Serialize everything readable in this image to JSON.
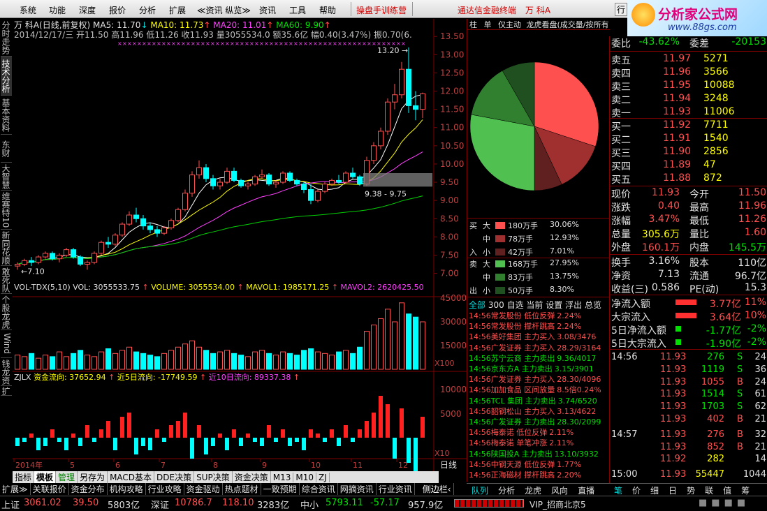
{
  "menu": {
    "items": [
      "系统",
      "功能",
      "深度",
      "报价",
      "分析",
      "扩展",
      "≪资讯 纵览≫",
      "资讯",
      "工具",
      "帮助"
    ],
    "promo": "操盘手训练营",
    "broker": "通达信金融终端",
    "stock_title": "万  科A",
    "right_btn": "行",
    "logo_text": "分析家公式网",
    "logo_url": "www.88gs.com"
  },
  "left_tabs": [
    "分时走势",
    "技术分析",
    "基本资料",
    "东财10",
    "大智慧",
    "维赛特10",
    "新同花顺",
    "敢死队",
    "个股龙虎",
    "Wind资讯",
    "钱龙资讯",
    "扩"
  ],
  "chart": {
    "title": "万  科A(日线,前复权)",
    "ma5": "MA5: 11.70",
    "ma10": "MA10: 11.73",
    "ma20": "MA20: 11.01",
    "ma60": "MA60: 9.90",
    "info_line": "2014/12/17/三  开11.50 高11.96 低11.26 收11.93 量3055534.0 额35.6亿 幅0.40(3.47%) 振0.70(6.07%) 换3",
    "high_label": "13.20",
    "low_label": "7.10",
    "range_label": "9.38 - 9.75",
    "price_ticks": [
      "13.50",
      "13.00",
      "12.50",
      "12.00",
      "11.50",
      "11.00",
      "10.50",
      "10.00",
      "9.50",
      "9.00",
      "8.50",
      "8.00",
      "7.50",
      "7.00"
    ],
    "vol_header": {
      "name": "VOL-TDX(5,10)",
      "vol": "VOL: 3055533.75",
      "volume": "VOLUME: 3055534.00",
      "mavol1": "MAVOL1: 1985171.25",
      "mavol2": "MAVOL2: 2620425.50"
    },
    "vol_ticks": [
      "45000",
      "30000",
      "15000"
    ],
    "vol_unit": "X100",
    "flow_header": {
      "name": "ZJLX",
      "flow": "资金流向: 37652.94",
      "d5": "近5日流向: -17749.59",
      "d10": "近10日流向: 89337.38"
    },
    "flow_ticks": [
      "10000",
      "5000"
    ],
    "flow_unit": "X10",
    "dates": [
      "2014年",
      "5",
      "6",
      "7",
      "8",
      "9",
      "10",
      "11",
      "12"
    ],
    "period": "日线"
  },
  "chart_tabs": [
    "指标",
    "模板",
    "管理",
    "另存为",
    "MACD基本",
    "DDE决策",
    "SUP决策",
    "资金决策",
    "M13",
    "M10",
    "ZJ"
  ],
  "pie": {
    "tabs": [
      "柱",
      "单",
      "仅主动",
      "龙虎看盘(成交量/按所有"
    ],
    "buy": [
      {
        "label": "大",
        "value": "180万手",
        "pct": "30.06%",
        "color": "#ff5050"
      },
      {
        "label": "中",
        "value": "78万手",
        "pct": "12.93%",
        "color": "#a03030"
      },
      {
        "label": "小",
        "value": "42万手",
        "pct": "7.01%",
        "color": "#602020"
      }
    ],
    "sell": [
      {
        "label": "大",
        "value": "168万手",
        "pct": "27.95%",
        "color": "#50c050"
      },
      {
        "label": "中",
        "value": "83万手",
        "pct": "13.75%",
        "color": "#308030"
      },
      {
        "label": "小",
        "value": "50万手",
        "pct": "8.30%",
        "color": "#205020"
      }
    ],
    "buy_side": [
      "买",
      "入"
    ],
    "sell_side": [
      "卖",
      "出"
    ]
  },
  "news": {
    "tabs": [
      "全部",
      "300",
      "自选",
      "当前",
      "设置",
      "浮出",
      "总览"
    ],
    "items": [
      {
        "t": "14:56",
        "s": "常发股份 低位反弹",
        "v": "2.24%",
        "c": "red"
      },
      {
        "t": "14:56",
        "s": "常发股份 撑杆跳高",
        "v": "2.24%",
        "c": "red"
      },
      {
        "t": "14:56",
        "s": "美好集团 主力买入",
        "v": "3.08/3476",
        "c": "red"
      },
      {
        "t": "14:56",
        "s": "广发证券 主力买入",
        "v": "28.29/3164",
        "c": "red"
      },
      {
        "t": "14:56",
        "s": "苏宁云商 主力卖出",
        "v": "9.36/4017",
        "c": "grn"
      },
      {
        "t": "14:56",
        "s": "京东方A 主力卖出",
        "v": "3.15/3901",
        "c": "grn"
      },
      {
        "t": "14:56",
        "s": "广发证券 主力买入",
        "v": "28.30/4096",
        "c": "red"
      },
      {
        "t": "14:56",
        "s": "加加食品 区间放量",
        "v": "8.5倍0.24%",
        "c": "red"
      },
      {
        "t": "14:56",
        "s": "TCL 集团 主力卖出",
        "v": "3.74/6520",
        "c": "grn"
      },
      {
        "t": "14:56",
        "s": "韶钢松山 主力买入",
        "v": "3.13/4622",
        "c": "red"
      },
      {
        "t": "14:56",
        "s": "广发证券 主力卖出",
        "v": "28.30/2099",
        "c": "grn"
      },
      {
        "t": "14:56",
        "s": "梅泰诺   低位反弹",
        "v": "2.11%",
        "c": "red"
      },
      {
        "t": "14:56",
        "s": "梅泰诺   单笔冲涨",
        "v": "2.11%",
        "c": "red"
      },
      {
        "t": "14:56",
        "s": "陕国投A 主力卖出",
        "v": "13.10/3932",
        "c": "grn"
      },
      {
        "t": "14:56",
        "s": "中钢天源 低位反弹",
        "v": "1.77%",
        "c": "red"
      },
      {
        "t": "14:56",
        "s": "正海磁材 撑杆跳高",
        "v": "2.20%",
        "c": "red"
      }
    ]
  },
  "right_tabs": [
    "队列",
    "分析",
    "龙虎",
    "风向",
    "直播"
  ],
  "orderbook": {
    "wb": {
      "l": "委比",
      "v": "-43.62%",
      "l2": "委差",
      "v2": "-20153"
    },
    "asks": [
      {
        "l": "卖五",
        "p": "11.97",
        "q": "5271"
      },
      {
        "l": "卖四",
        "p": "11.96",
        "q": "3566"
      },
      {
        "l": "卖三",
        "p": "11.95",
        "q": "10088"
      },
      {
        "l": "卖二",
        "p": "11.94",
        "q": "3248"
      },
      {
        "l": "卖一",
        "p": "11.93",
        "q": "11006"
      }
    ],
    "bids": [
      {
        "l": "买一",
        "p": "11.92",
        "q": "7711"
      },
      {
        "l": "买二",
        "p": "11.91",
        "q": "1540"
      },
      {
        "l": "买三",
        "p": "11.90",
        "q": "2856"
      },
      {
        "l": "买四",
        "p": "11.89",
        "q": "47"
      },
      {
        "l": "买五",
        "p": "11.88",
        "q": "872"
      }
    ],
    "stats": [
      {
        "l": "现价",
        "v": "11.93",
        "l2": "今开",
        "v2": "11.50"
      },
      {
        "l": "涨跌",
        "v": "0.40",
        "l2": "最高",
        "v2": "11.96"
      },
      {
        "l": "涨幅",
        "v": "3.47%",
        "l2": "最低",
        "v2": "11.26"
      },
      {
        "l": "总量",
        "v": "305.6万",
        "l2": "量比",
        "v2": "1.60"
      },
      {
        "l": "外盘",
        "v": "160.1万",
        "l2": "内盘",
        "v2": "145.5万"
      }
    ],
    "stats2": [
      {
        "l": "换手",
        "v": "3.16%",
        "l2": "股本",
        "v2": "110亿"
      },
      {
        "l": "净资",
        "v": "7.13",
        "l2": "流通",
        "v2": "96.7亿"
      },
      {
        "l": "收益(三)",
        "v": "0.586",
        "l2": "PE(动)",
        "v2": "15.3"
      }
    ],
    "flows": [
      {
        "l": "净流入额",
        "v": "3.77亿",
        "p": "11%",
        "c": "red"
      },
      {
        "l": "大宗流入",
        "v": "3.64亿",
        "p": "10%",
        "c": "red"
      },
      {
        "l": "5日净流入额",
        "v": "-1.77亿",
        "p": "-2%",
        "c": "grn"
      },
      {
        "l": "5日大宗流入",
        "v": "-1.90亿",
        "p": "-2%",
        "c": "grn"
      }
    ],
    "ticks": [
      {
        "t": "14:56",
        "p": "11.93",
        "q": "276",
        "d": "S",
        "n": "24"
      },
      {
        "t": "",
        "p": "11.93",
        "q": "1119",
        "d": "S",
        "n": "36"
      },
      {
        "t": "",
        "p": "11.93",
        "q": "1055",
        "d": "B",
        "n": "24"
      },
      {
        "t": "",
        "p": "11.93",
        "q": "1514",
        "d": "S",
        "n": "61"
      },
      {
        "t": "",
        "p": "11.93",
        "q": "1703",
        "d": "S",
        "n": "62"
      },
      {
        "t": "",
        "p": "11.93",
        "q": "402",
        "d": "B",
        "n": "21"
      },
      {
        "t": "14:57",
        "p": "11.93",
        "q": "276",
        "d": "B",
        "n": "32"
      },
      {
        "t": "",
        "p": "11.93",
        "q": "852",
        "d": "B",
        "n": "21"
      },
      {
        "t": "",
        "p": "11.92",
        "q": "282",
        "d": "",
        "n": "14"
      },
      {
        "t": "15:00",
        "p": "11.93",
        "q": "55447",
        "d": "",
        "n": "1044"
      }
    ],
    "bottom_tabs": [
      "笔",
      "价",
      "细",
      "日",
      "势",
      "联",
      "值",
      "筹"
    ]
  },
  "bottom_tabs": [
    "扩展≫",
    "关联报价",
    "资金分布",
    "机构攻略",
    "行业攻略",
    "资金驱动",
    "热点题材",
    "一致预期",
    "综合资讯",
    "网摘资讯",
    "行业资讯",
    "侧边栏‹"
  ],
  "status": {
    "sh_label": "上证",
    "sh_val": "3061.02",
    "sh_chg": "39.50",
    "sh_amt": "5803亿",
    "sz_label": "深证",
    "sz_val": "10786.7",
    "sz_chg": "118.10",
    "sz_amt": "3283亿",
    "zx_label": "中小",
    "zx_val": "5793.11",
    "zx_chg": "-57.17",
    "zx_amt": "957.9亿",
    "conn": "VIP_招商北京5"
  },
  "candles": [
    [
      7.2,
      7.3,
      7.1,
      7.25
    ],
    [
      7.25,
      7.4,
      7.2,
      7.35
    ],
    [
      7.35,
      7.45,
      7.2,
      7.3
    ],
    [
      7.3,
      7.5,
      7.25,
      7.45
    ],
    [
      7.45,
      7.6,
      7.4,
      7.55
    ],
    [
      7.55,
      7.6,
      7.35,
      7.4
    ],
    [
      7.4,
      7.55,
      7.3,
      7.5
    ],
    [
      7.5,
      7.7,
      7.45,
      7.65
    ],
    [
      7.65,
      7.7,
      7.4,
      7.45
    ],
    [
      7.45,
      7.5,
      7.2,
      7.25
    ],
    [
      7.25,
      7.35,
      7.1,
      7.3
    ],
    [
      7.3,
      7.6,
      7.25,
      7.55
    ],
    [
      7.55,
      7.9,
      7.5,
      7.85
    ],
    [
      7.85,
      8.0,
      7.7,
      7.8
    ],
    [
      7.8,
      8.1,
      7.75,
      8.05
    ],
    [
      8.05,
      8.4,
      8.0,
      8.35
    ],
    [
      8.35,
      8.7,
      8.3,
      8.6
    ],
    [
      8.6,
      8.8,
      8.4,
      8.5
    ],
    [
      8.5,
      8.6,
      8.2,
      8.3
    ],
    [
      8.3,
      8.4,
      8.1,
      8.2
    ],
    [
      8.2,
      8.3,
      8.0,
      8.1
    ],
    [
      8.1,
      8.3,
      8.05,
      8.25
    ],
    [
      8.25,
      8.5,
      8.2,
      8.45
    ],
    [
      8.45,
      8.8,
      8.4,
      8.75
    ],
    [
      8.75,
      9.3,
      8.7,
      9.2
    ],
    [
      9.2,
      9.8,
      9.1,
      9.7
    ],
    [
      9.7,
      10.1,
      9.6,
      9.9
    ],
    [
      9.9,
      10.0,
      9.5,
      9.6
    ],
    [
      9.6,
      9.7,
      9.3,
      9.4
    ],
    [
      9.4,
      9.6,
      9.3,
      9.5
    ],
    [
      9.5,
      9.9,
      9.45,
      9.8
    ],
    [
      9.8,
      9.9,
      9.5,
      9.55
    ],
    [
      9.55,
      9.6,
      9.35,
      9.4
    ],
    [
      9.4,
      9.5,
      9.3,
      9.45
    ],
    [
      9.45,
      9.7,
      9.4,
      9.65
    ],
    [
      9.65,
      9.85,
      9.6,
      9.7
    ],
    [
      9.7,
      9.75,
      9.4,
      9.45
    ],
    [
      9.45,
      9.55,
      9.35,
      9.5
    ],
    [
      9.5,
      9.8,
      9.45,
      9.75
    ],
    [
      9.75,
      9.8,
      9.5,
      9.55
    ],
    [
      9.55,
      9.6,
      9.4,
      9.45
    ],
    [
      9.45,
      9.5,
      9.2,
      9.3
    ],
    [
      9.3,
      9.45,
      8.9,
      9.0
    ],
    [
      9.0,
      9.3,
      8.95,
      9.25
    ],
    [
      9.25,
      9.5,
      9.2,
      9.45
    ],
    [
      9.45,
      9.6,
      9.4,
      9.55
    ],
    [
      9.55,
      9.7,
      9.45,
      9.5
    ],
    [
      9.5,
      9.8,
      9.45,
      9.75
    ],
    [
      9.75,
      9.9,
      9.6,
      9.65
    ],
    [
      9.65,
      9.7,
      9.4,
      9.45
    ],
    [
      9.45,
      10.2,
      9.4,
      10.1
    ],
    [
      10.1,
      10.6,
      10.0,
      10.5
    ],
    [
      10.5,
      11.0,
      10.4,
      10.9
    ],
    [
      10.9,
      11.8,
      10.8,
      11.7
    ],
    [
      11.7,
      12.2,
      11.5,
      11.9
    ],
    [
      11.9,
      12.8,
      11.8,
      12.6
    ],
    [
      12.6,
      13.2,
      11.4,
      11.6
    ],
    [
      11.6,
      12.0,
      11.2,
      11.5
    ],
    [
      11.5,
      11.96,
      11.26,
      11.93
    ]
  ],
  "volumes": [
    9,
    8,
    10,
    7,
    9,
    8,
    11,
    8,
    10,
    12,
    9,
    8,
    11,
    13,
    10,
    12,
    14,
    11,
    10,
    9,
    8,
    10,
    12,
    14,
    16,
    18,
    14,
    12,
    10,
    11,
    12,
    10,
    9,
    8,
    11,
    12,
    10,
    9,
    11,
    10,
    9,
    12,
    13,
    11,
    10,
    9,
    11,
    12,
    10,
    14,
    24,
    28,
    32,
    38,
    30,
    42,
    35,
    33,
    30
  ],
  "flows": [
    -2,
    -1,
    1,
    -3,
    -2,
    2,
    -1,
    -3,
    1,
    -2,
    3,
    -1,
    2,
    4,
    -3,
    5,
    6,
    -4,
    -2,
    -3,
    2,
    -1,
    3,
    4,
    6,
    -5,
    3,
    -4,
    -2,
    1,
    -3,
    2,
    -2,
    1,
    -1,
    -2,
    3,
    -1,
    2,
    -2,
    -1,
    -3,
    2,
    1,
    -1,
    2,
    -2,
    3,
    -1,
    2,
    4,
    6,
    10,
    8,
    -5,
    7,
    -6,
    -8,
    5
  ]
}
